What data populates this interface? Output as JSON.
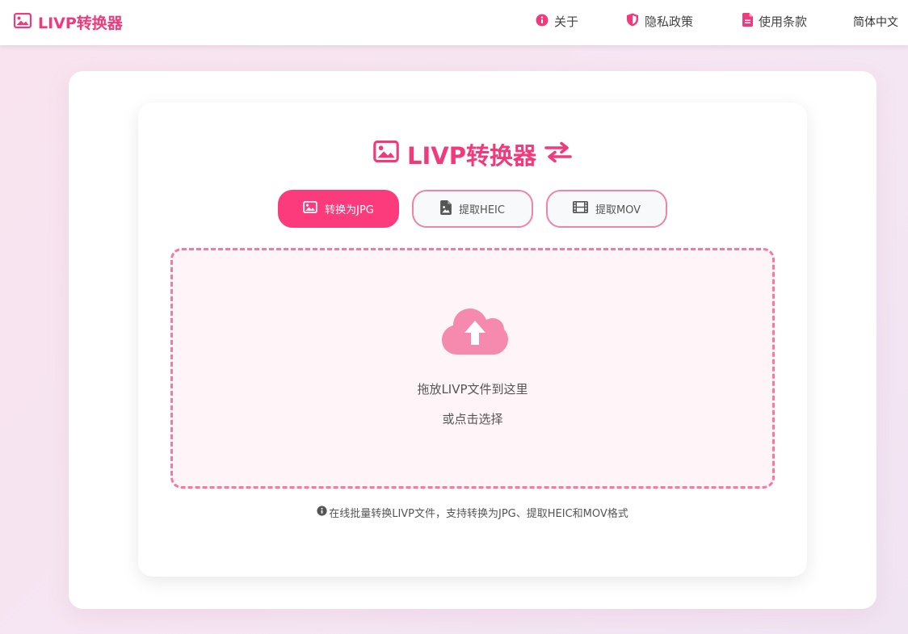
{
  "nav": {
    "brand": "LIVP转换器",
    "about": "关于",
    "privacy": "隐私政策",
    "terms": "使用条款",
    "language": "简体中文"
  },
  "main": {
    "title": "LIVP转换器",
    "tabs": [
      {
        "label": "转换为JPG",
        "active": true
      },
      {
        "label": "提取HEIC",
        "active": false
      },
      {
        "label": "提取MOV",
        "active": false
      }
    ],
    "dropzone": {
      "line1": "拖放LIVP文件到这里",
      "line2": "或点击选择"
    },
    "info": "在线批量转换LIVP文件，支持转换为JPG、提取HEIC和MOV格式"
  },
  "colors": {
    "accent": "#f03a7c",
    "tab_active_bg": "#fc3b7c",
    "dashed_border": "#f57aa3",
    "dropzone_bg": "#fff5f8"
  },
  "icons": [
    "image-icon",
    "info-icon",
    "shield-icon",
    "document-icon",
    "swap-arrows-icon",
    "file-image-icon",
    "film-icon",
    "cloud-upload-icon"
  ]
}
